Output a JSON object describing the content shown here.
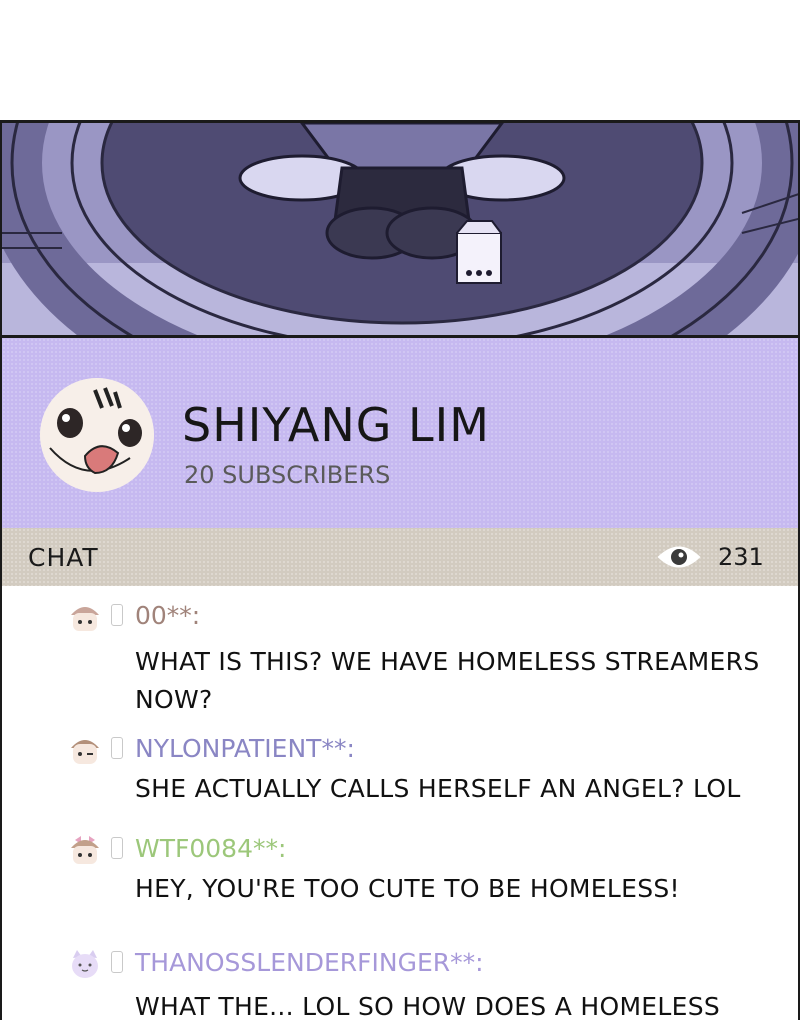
{
  "channel": {
    "name": "SHIYANG LIM",
    "subscribers": "20 SUBSCRIBERS"
  },
  "chat_bar": {
    "label": "CHAT",
    "viewer_count": "231",
    "icon": "eye-icon"
  },
  "colors": {
    "channel_bg": "#c6b9f0",
    "chat_bar_bg": "#d2cbc0",
    "scene_bg": "#8f8ab8"
  },
  "messages": [
    {
      "username": "00**:",
      "color": "#a0837a",
      "text": "WHAT IS THIS? WE HAVE HOMELESS STREAMERS NOW?"
    },
    {
      "username": "NYLONPATIENT**:",
      "color": "#8a86c4",
      "text": "SHE ACTUALLY CALLS HERSELF AN ANGEL? LOL"
    },
    {
      "username": "WTF0084**:",
      "color": "#9cc77a",
      "text": "HEY, YOU'RE TOO CUTE TO BE HOMELESS!"
    },
    {
      "username": "THANOSSLENDERFINGER**:",
      "color": "#a698d9",
      "text": "WHAT THE... LOL SO HOW DOES A HOMELESS"
    }
  ]
}
